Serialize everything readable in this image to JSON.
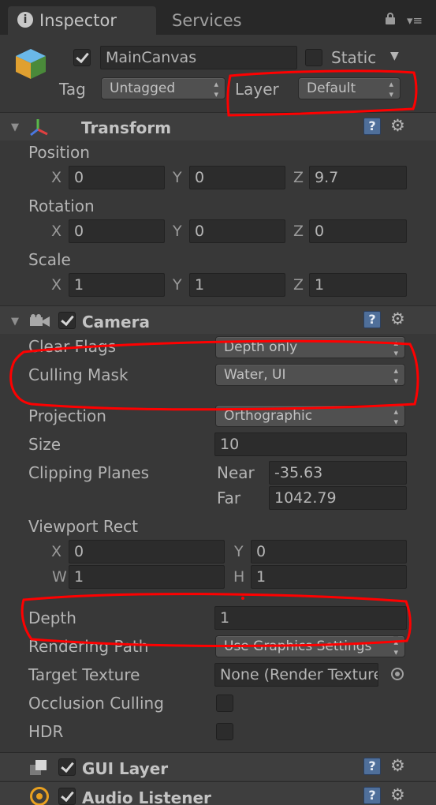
{
  "tabs": {
    "inspector": "Inspector",
    "services": "Services"
  },
  "header": {
    "name": "MainCanvas",
    "static_label": "Static",
    "tag_label": "Tag",
    "tag_value": "Untagged",
    "layer_label": "Layer",
    "layer_value": "Default"
  },
  "transform": {
    "title": "Transform",
    "position_label": "Position",
    "rotation_label": "Rotation",
    "scale_label": "Scale",
    "axis_x": "X",
    "axis_y": "Y",
    "axis_z": "Z",
    "position": {
      "x": "0",
      "y": "0",
      "z": "9.7"
    },
    "rotation": {
      "x": "0",
      "y": "0",
      "z": "0"
    },
    "scale": {
      "x": "1",
      "y": "1",
      "z": "1"
    }
  },
  "camera": {
    "title": "Camera",
    "clear_flags_label": "Clear Flags",
    "clear_flags_value": "Depth only",
    "culling_mask_label": "Culling Mask",
    "culling_mask_value": "Water, UI",
    "projection_label": "Projection",
    "projection_value": "Orthographic",
    "size_label": "Size",
    "size_value": "10",
    "clipping_label": "Clipping Planes",
    "near_label": "Near",
    "near_value": "-35.63",
    "far_label": "Far",
    "far_value": "1042.79",
    "viewport_label": "Viewport Rect",
    "vp_x_label": "X",
    "vp_x": "0",
    "vp_y_label": "Y",
    "vp_y": "0",
    "vp_w_label": "W",
    "vp_w": "1",
    "vp_h_label": "H",
    "vp_h": "1",
    "depth_label": "Depth",
    "depth_value": "1",
    "rendering_path_label": "Rendering Path",
    "rendering_path_value": "Use Graphics Settings",
    "target_texture_label": "Target Texture",
    "target_texture_value": "None (Render Texture)",
    "occlusion_label": "Occlusion Culling",
    "hdr_label": "HDR"
  },
  "components": {
    "gui_layer": "GUI Layer",
    "audio_listener": "Audio Listener"
  },
  "icons": {
    "help": "?",
    "gear": "⚙"
  },
  "colors": {
    "annotation": "#ff0000",
    "background": "#383838"
  }
}
